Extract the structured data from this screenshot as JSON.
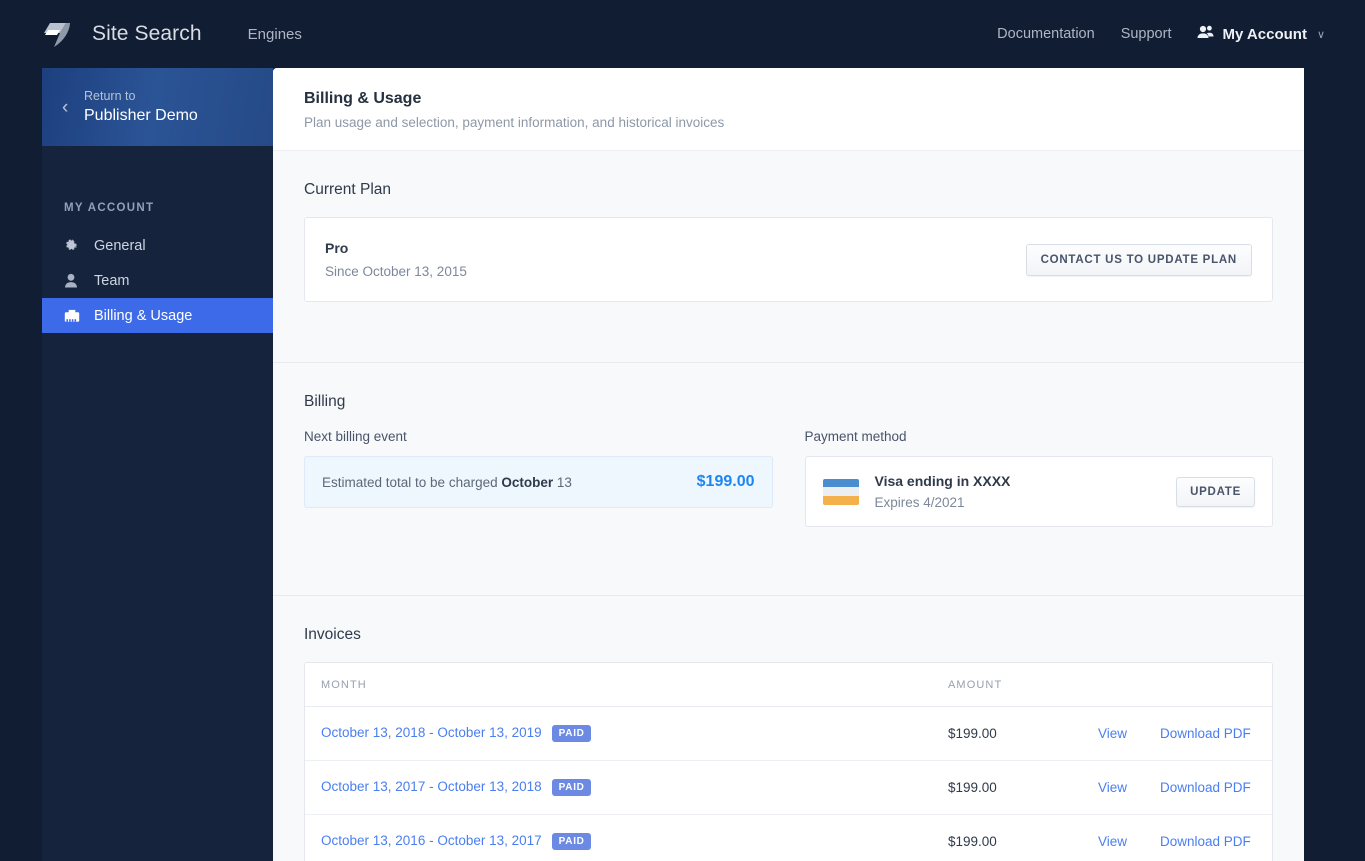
{
  "topbar": {
    "logo_icon": "lightning-bolt-logo",
    "brand": "Site Search",
    "engines": "Engines",
    "documentation": "Documentation",
    "support": "Support",
    "account": "My Account",
    "account_icon": "people-icon",
    "caret": "∨",
    "bg": "#111d33"
  },
  "sidebar": {
    "return_chevron": "‹",
    "return_label": "Return to",
    "return_title": "Publisher Demo",
    "section_title": "MY ACCOUNT",
    "items": [
      {
        "label": "General",
        "icon": "gear-icon",
        "active": false
      },
      {
        "label": "Team",
        "icon": "person-icon",
        "active": false
      },
      {
        "label": "Billing & Usage",
        "icon": "briefcase-icon",
        "active": true
      }
    ],
    "active_color": "#3c6ae8",
    "bg": "#16233d"
  },
  "header": {
    "title": "Billing & Usage",
    "subtitle": "Plan usage and selection, payment information, and historical invoices"
  },
  "current_plan": {
    "heading": "Current Plan",
    "plan_name": "Pro",
    "since": "Since October 13, 2015",
    "update_button": "CONTACT US TO UPDATE PLAN"
  },
  "billing": {
    "heading": "Billing",
    "next_billing_label": "Next billing event",
    "estimate_prefix": "Estimated total to be charged ",
    "estimate_month": "October",
    "estimate_day": " 13",
    "estimate_amount": "$199.00",
    "amount_color": "#1e86f0",
    "payment_method_label": "Payment method",
    "card_icon": "visa-card-icon",
    "card_title": "Visa ending in XXXX",
    "card_expires": "Expires 4/2021",
    "update_button": "UPDATE"
  },
  "invoices": {
    "heading": "Invoices",
    "columns": {
      "month": "MONTH",
      "amount": "AMOUNT"
    },
    "badge": "PAID",
    "view": "View",
    "download": "Download PDF",
    "rows": [
      {
        "month": "October 13, 2018 - October 13, 2019",
        "status": "PAID",
        "amount": "$199.00",
        "view": "View",
        "download": "Download PDF"
      },
      {
        "month": "October 13, 2017 - October 13, 2018",
        "status": "PAID",
        "amount": "$199.00",
        "view": "View",
        "download": "Download PDF"
      },
      {
        "month": "October 13, 2016 - October 13, 2017",
        "status": "PAID",
        "amount": "$199.00",
        "view": "View",
        "download": "Download PDF"
      }
    ]
  }
}
